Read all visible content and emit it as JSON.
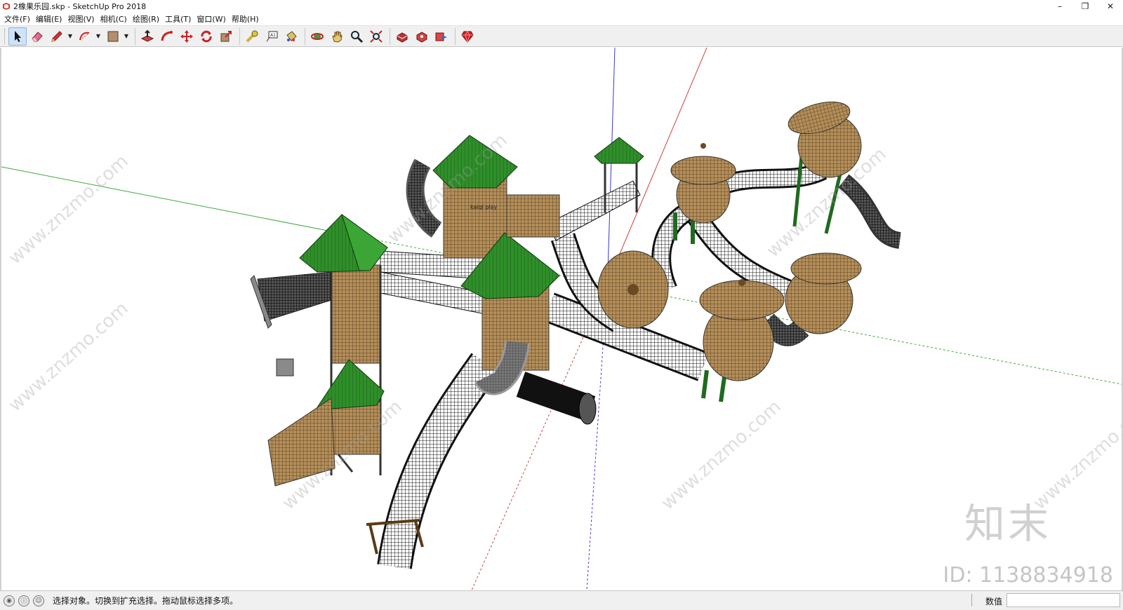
{
  "window": {
    "title": "2橡果乐园.skp - SketchUp Pro 2018",
    "minimize": "–",
    "restore": "❐",
    "close": "✕"
  },
  "menu": [
    {
      "label": "文件(F)"
    },
    {
      "label": "编辑(E)"
    },
    {
      "label": "视图(V)"
    },
    {
      "label": "相机(C)"
    },
    {
      "label": "绘图(R)"
    },
    {
      "label": "工具(T)"
    },
    {
      "label": "窗口(W)"
    },
    {
      "label": "帮助(H)"
    }
  ],
  "toolbar": {
    "tools": [
      "select-icon",
      "eraser-icon",
      "pencil-icon",
      "arc-icon",
      "rectangle-icon",
      "push-pull-icon",
      "follow-me-icon",
      "move-icon",
      "rotate-icon",
      "scale-icon",
      "tape-measure-icon",
      "text-icon",
      "paint-bucket-icon",
      "orbit-icon",
      "pan-icon",
      "zoom-icon",
      "zoom-extents-icon",
      "3d-warehouse-icon",
      "extension-warehouse-icon",
      "layout-icon",
      "ruby-icon"
    ]
  },
  "viewport": {
    "watermark_logo": "知末",
    "watermark_id": "ID: 1138834918",
    "watermark_site": "www.znzmo.com",
    "colors": {
      "roof_green": "#2f8f2a",
      "wood": "#a5814f",
      "net": "#222222",
      "axis_red": "#d04040",
      "axis_green": "#3cab3c",
      "axis_blue": "#3a3ad0"
    }
  },
  "status": {
    "message": "选择对象。切换到扩充选择。拖动鼠标选择多项。",
    "measure_label": "数值",
    "measure_value": ""
  }
}
